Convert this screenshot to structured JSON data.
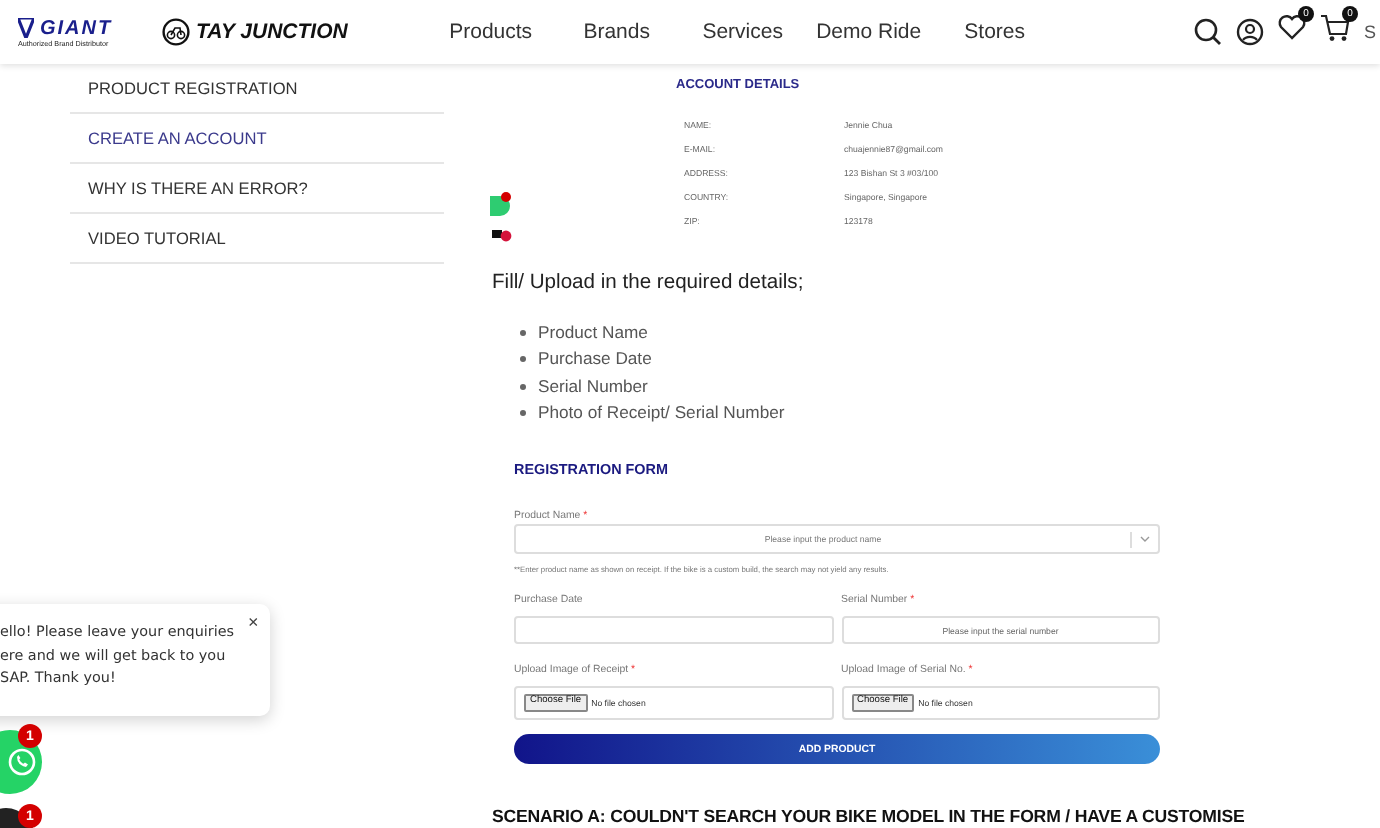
{
  "header": {
    "brand_logo": {
      "name": "GIANT",
      "tagline": "Authorized Brand Distributor"
    },
    "store_logo": {
      "name": "TAY JUNCTION"
    },
    "nav": [
      {
        "label": "Products"
      },
      {
        "label": "Brands"
      },
      {
        "label": "Services"
      },
      {
        "label": "Demo Ride"
      },
      {
        "label": "Stores"
      }
    ],
    "wishlist_count": "0",
    "cart_count": "0",
    "currency": "S"
  },
  "sidebar": {
    "items": [
      {
        "label": "PRODUCT REGISTRATION",
        "selected": false
      },
      {
        "label": "CREATE AN ACCOUNT",
        "selected": true
      },
      {
        "label": "WHY IS THERE AN ERROR?",
        "selected": false
      },
      {
        "label": "VIDEO TUTORIAL",
        "selected": false
      }
    ]
  },
  "account_details": {
    "title": "ACCOUNT DETAILS",
    "rows": [
      {
        "label": "NAME:",
        "value": "Jennie Chua"
      },
      {
        "label": "E-MAIL:",
        "value": "chuajennie87@gmail.com"
      },
      {
        "label": "ADDRESS:",
        "value": "123 Bishan St 3 #03/100"
      },
      {
        "label": "COUNTRY:",
        "value": "Singapore, Singapore"
      },
      {
        "label": "ZIP:",
        "value": "123178"
      }
    ]
  },
  "instructions": {
    "heading": "Fill/ Upload in the required details;",
    "items": [
      "Product Name",
      "Purchase Date",
      "Serial Number",
      "Photo of Receipt/ Serial Number"
    ]
  },
  "registration_form": {
    "title": "REGISTRATION FORM",
    "required_mark": "*",
    "product_name": {
      "label": "Product Name",
      "required": true,
      "placeholder": "Please input the product name"
    },
    "hint": "**Enter product name as shown on receipt. If the bike is a custom build, the search may not yield any results.",
    "rows": [
      [
        {
          "kind": "text",
          "label": "Purchase Date",
          "required": false
        },
        {
          "kind": "text",
          "label": "Serial Number",
          "required": true,
          "placeholder": "Please input the serial number"
        }
      ],
      [
        {
          "kind": "file",
          "label": "Upload Image of Receipt",
          "required": true,
          "file_button": "Choose File",
          "file_status": "No file chosen"
        },
        {
          "kind": "file",
          "label": "Upload Image of Serial No.",
          "required": true,
          "file_button": "Choose File",
          "file_status": "No file chosen"
        }
      ]
    ],
    "submit": "ADD PRODUCT"
  },
  "section_heading": "SCENARIO A: COULDN'T SEARCH YOUR BIKE MODEL IN THE FORM / HAVE A CUSTOMISE",
  "chat": {
    "message_lines": [
      "ello! Please leave your enquiries",
      "ere and we will get back to you",
      "SAP. Thank you!"
    ],
    "close": "×",
    "whatsapp_badge": "1",
    "messenger_badge": "1"
  }
}
